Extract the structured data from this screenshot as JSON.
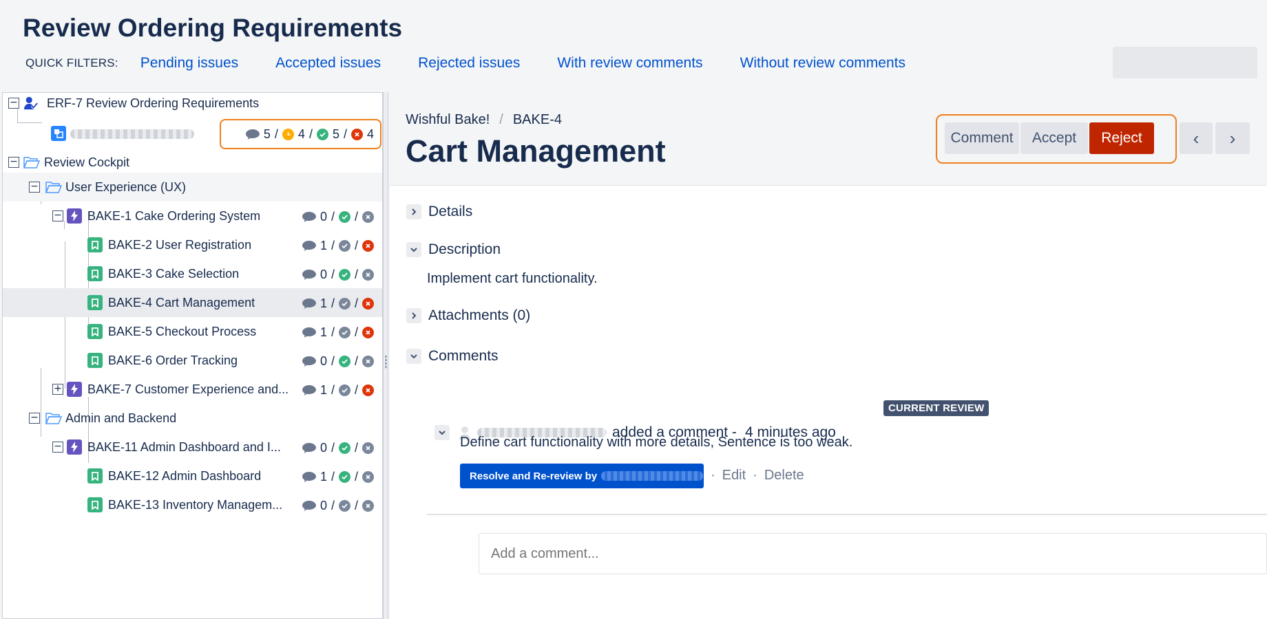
{
  "page": {
    "title": "Review Ordering Requirements"
  },
  "filters": {
    "label": "QUICK FILTERS:",
    "items": [
      "Pending issues",
      "Accepted issues",
      "Rejected issues",
      "With review comments",
      "Without review comments"
    ]
  },
  "tree": {
    "root": {
      "label": "ERF-7 Review Ordering Requirements",
      "stats": {
        "comments": "5",
        "pending": "4",
        "accepted": "5",
        "rejected": "4"
      }
    },
    "cockpit": {
      "label": "Review Cockpit"
    },
    "groups": [
      {
        "label": "User Experience (UX)"
      },
      {
        "label": "Admin and Backend"
      }
    ],
    "items": [
      {
        "label": "BAKE-1 Cake Ordering System",
        "comments": "0",
        "status": "accepted"
      },
      {
        "label": "BAKE-2 User Registration",
        "comments": "1",
        "status": "rejected"
      },
      {
        "label": "BAKE-3 Cake Selection",
        "comments": "0",
        "status": "accepted"
      },
      {
        "label": "BAKE-4 Cart Management",
        "comments": "1",
        "status": "rejected"
      },
      {
        "label": "BAKE-5 Checkout Process",
        "comments": "1",
        "status": "rejected"
      },
      {
        "label": "BAKE-6 Order Tracking",
        "comments": "0",
        "status": "accepted"
      },
      {
        "label": "BAKE-7 Customer Experience and...",
        "comments": "1",
        "status": "rejected"
      },
      {
        "label": "BAKE-11 Admin Dashboard and I...",
        "comments": "0",
        "status": "accepted"
      },
      {
        "label": "BAKE-12 Admin Dashboard",
        "comments": "1",
        "status": "accepted"
      },
      {
        "label": "BAKE-13 Inventory Managem...",
        "comments": "0",
        "status": "none"
      }
    ],
    "slash": "/"
  },
  "issue": {
    "project": "Wishful Bake!",
    "key": "BAKE-4",
    "crumb_sep": "/",
    "title": "Cart Management",
    "actions": {
      "comment": "Comment",
      "accept": "Accept",
      "reject": "Reject"
    },
    "nav": {
      "prev": "‹",
      "next": "›"
    },
    "sections": {
      "details": "Details",
      "description": "Description",
      "attachments": "Attachments (0)",
      "comments": "Comments"
    },
    "description_text": "Implement cart functionality."
  },
  "comment": {
    "action_text": "added a comment -",
    "time": "4 minutes ago",
    "badge": "CURRENT REVIEW",
    "body": "Define cart functionality with more details, Sentence is too weak.",
    "resolve_label": "Resolve and Re-review by",
    "edit": "Edit",
    "delete": "Delete",
    "dot": "·"
  },
  "add_comment": {
    "placeholder": "Add a comment..."
  },
  "colors": {
    "accent": "#0052cc",
    "reject": "#bf2600",
    "accepted": "#36b37e",
    "rejected": "#de350b",
    "pending": "#ffab00",
    "highlight": "#f07e1a"
  }
}
